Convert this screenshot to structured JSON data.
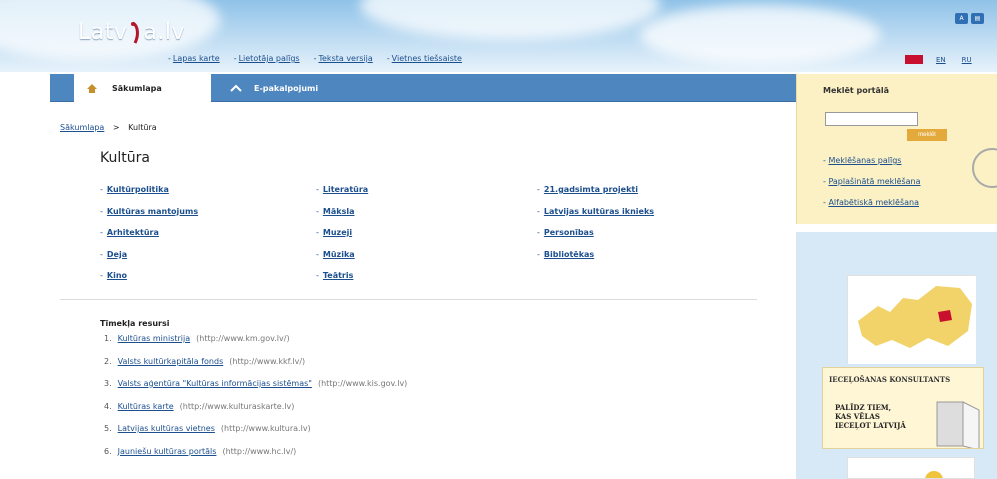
{
  "header": {
    "logo_text_left": "Latv",
    "logo_text_right": "a.lv",
    "top_links": [
      "Lapas karte",
      "Lietotāja palīgs",
      "Teksta versija",
      "Vietnes tiešsaiste"
    ],
    "languages": [
      "LV",
      "EN",
      "RU"
    ],
    "active_language": "LV"
  },
  "nav": {
    "tabs": [
      {
        "label": "Sākumlapa",
        "icon": "home-icon"
      },
      {
        "label": "E-pakalpojumi",
        "icon": "e-service-icon"
      }
    ]
  },
  "breadcrumb": {
    "home": "Sākumlapa",
    "separator": ">",
    "current": "Kultūra"
  },
  "page": {
    "title": "Kultūra",
    "columns": [
      [
        "Kultūrpolitika",
        "Kultūras mantojums",
        "Arhitektūra",
        "Deja",
        "Kino"
      ],
      [
        "Literatūra",
        "Māksla",
        "Muzeji",
        "Mūzika",
        "Teātris"
      ],
      [
        "21.gadsimta projekti",
        "Latvijas kultūras iknieks",
        "Personības",
        "Bibliotēkas"
      ]
    ],
    "resources_title": "Tīmekļa resursi",
    "resources": [
      {
        "num": "1.",
        "label": "Kultūras ministrija",
        "url": "(http://www.km.gov.lv/)"
      },
      {
        "num": "2.",
        "label": "Valsts kultūrkapitāla fonds",
        "url": "(http://www.kkf.lv/)"
      },
      {
        "num": "3.",
        "label": "Valsts aģentūra \"Kultūras informācijas sistēmas\"",
        "url": "(http://www.kis.gov.lv)"
      },
      {
        "num": "4.",
        "label": "Kultūras karte",
        "url": "(http://www.kulturaskarte.lv)"
      },
      {
        "num": "5.",
        "label": "Latvijas kultūras vietnes",
        "url": "(http://www.kultura.lv)"
      },
      {
        "num": "6.",
        "label": "Jauniešu kultūras portāls",
        "url": "(http://www.hc.lv/)"
      }
    ]
  },
  "sidebar": {
    "search_title": "Meklēt portālā",
    "search_value": "",
    "search_button": "meklēt",
    "help_links": [
      "Meklēšanas palīgs",
      "Paplašinātā meklēšana",
      "Alfabētiskā meklēšana"
    ],
    "consult_title": "IECEĻOŠANAS KONSULTANTS",
    "consult_body": [
      "PALĪDZ TIEM,",
      "KAS VĒLAS",
      "IECEĻOT LATVIJĀ"
    ]
  },
  "colors": {
    "nav_blue": "#4e86bf",
    "link_blue": "#1c4f8e",
    "search_panel": "#fbf1c4",
    "sidebar_blue": "#d7e8f7"
  }
}
